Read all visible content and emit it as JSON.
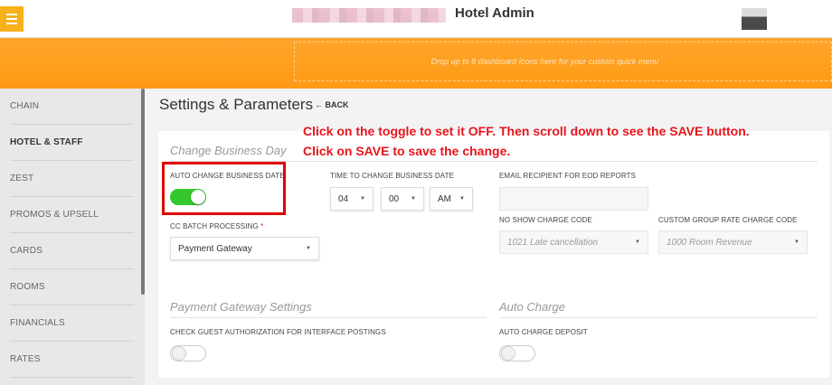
{
  "header": {
    "title": "Hotel Admin",
    "menu_icon": "hamburger-menu-icon",
    "avatar": "user-avatar"
  },
  "quickbar": {
    "dropzone_text": "Drop up to 8 dashboard icons here for your custom quick menu"
  },
  "sidebar": {
    "items": [
      {
        "label": "CHAIN",
        "active": false
      },
      {
        "label": "HOTEL & STAFF",
        "active": true
      },
      {
        "label": "ZEST",
        "active": false
      },
      {
        "label": "PROMOS & UPSELL",
        "active": false
      },
      {
        "label": "CARDS",
        "active": false
      },
      {
        "label": "ROOMS",
        "active": false
      },
      {
        "label": "FINANCIALS",
        "active": false
      },
      {
        "label": "RATES",
        "active": false
      }
    ]
  },
  "main": {
    "page_title": "Settings & Parameters",
    "back_label": "← BACK"
  },
  "change_business_day": {
    "section_title": "Change Business Day",
    "auto_change_label": "AUTO CHANGE BUSINESS DATE",
    "auto_change_on": true,
    "time_label": "TIME TO CHANGE BUSINESS DATE",
    "time_hour": "04",
    "time_minute": "00",
    "time_ampm": "AM",
    "email_label": "EMAIL RECIPIENT FOR EOD REPORTS",
    "email_value": "",
    "cc_batch_label": "CC BATCH PROCESSING",
    "cc_batch_required": "*",
    "cc_batch_value": "Payment Gateway",
    "no_show_label": "NO SHOW CHARGE CODE",
    "no_show_value": "1021 Late cancellation",
    "group_rate_label": "CUSTOM GROUP RATE CHARGE CODE",
    "group_rate_value": "1000 Room Revenue"
  },
  "payment_gateway": {
    "section_title": "Payment Gateway Settings",
    "check_auth_label": "CHECK GUEST AUTHORIZATION FOR INTERFACE POSTINGS",
    "check_auth_on": false
  },
  "auto_charge": {
    "section_title": "Auto Charge",
    "deposit_label": "AUTO CHARGE DEPOSIT",
    "deposit_on": false
  },
  "annotation": {
    "line1": "Click on the toggle to set it OFF. Then scroll down to see the SAVE button.",
    "line2": "Click on SAVE to save the change."
  },
  "colors": {
    "accent_orange": "#ff9a14",
    "menu_yellow": "#f7b21b",
    "toggle_on": "#34c82c",
    "annotation_red": "#e8141c"
  }
}
